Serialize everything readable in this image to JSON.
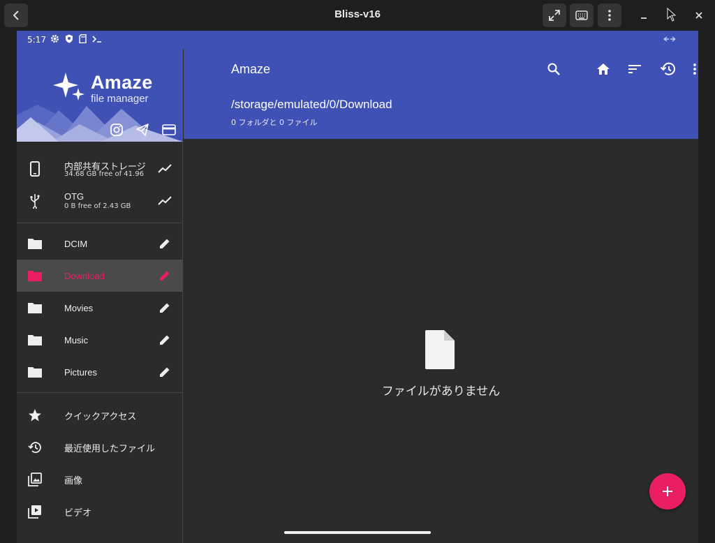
{
  "window": {
    "title": "Bliss-v16"
  },
  "status": {
    "time": "5:17"
  },
  "drawer": {
    "logo_title": "Amaze",
    "logo_subtitle": "file manager",
    "storage": [
      {
        "label": "内部共有ストレージ",
        "sub": "34.68 GB free of 41.96"
      },
      {
        "label": "OTG",
        "sub": "0 B free of 2.43 GB"
      }
    ],
    "folders": [
      {
        "label": "DCIM"
      },
      {
        "label": "Download",
        "active": true
      },
      {
        "label": "Movies"
      },
      {
        "label": "Music"
      },
      {
        "label": "Pictures"
      }
    ],
    "quick": [
      {
        "label": "クイックアクセス",
        "icon": "star-icon"
      },
      {
        "label": "最近使用したファイル",
        "icon": "history-icon"
      },
      {
        "label": "画像",
        "icon": "image-icon"
      },
      {
        "label": "ビデオ",
        "icon": "video-icon"
      }
    ]
  },
  "toolbar": {
    "title": "Amaze",
    "path": "/storage/emulated/0/Download",
    "summary": "0 フォルダと 0 ファイル"
  },
  "main": {
    "empty_text": "ファイルがありません"
  },
  "colors": {
    "primary": "#3f51b5",
    "accent": "#e91e63",
    "background": "#2b2b2b"
  }
}
